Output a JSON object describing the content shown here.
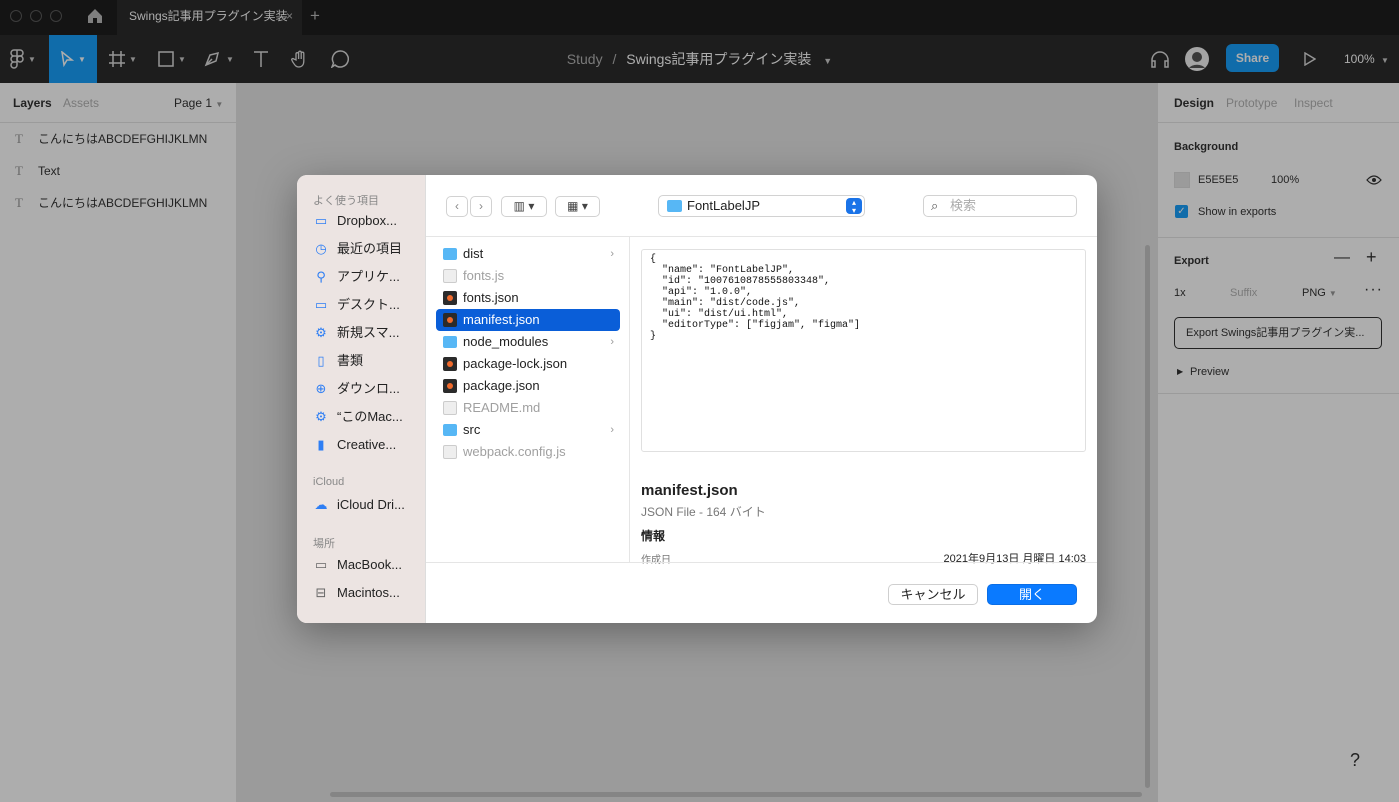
{
  "titlebar": {
    "tab_title": "Swings記事用プラグイン実装",
    "tab_close": "×",
    "new_tab": "+"
  },
  "toolbar": {
    "breadcrumb_project": "Study",
    "breadcrumb_separator": "/",
    "breadcrumb_file": "Swings記事用プラグイン実装",
    "share_label": "Share",
    "zoom": "100%"
  },
  "left_panel": {
    "tabs": [
      "Layers",
      "Assets"
    ],
    "page": "Page 1",
    "layers": [
      {
        "icon": "T",
        "label": "こんにちはABCDEFGHIJKLMN"
      },
      {
        "icon": "T",
        "label": "Text"
      },
      {
        "icon": "T",
        "label": "こんにちはABCDEFGHIJKLMN"
      }
    ]
  },
  "right_panel": {
    "tabs": [
      "Design",
      "Prototype",
      "Inspect"
    ],
    "background_title": "Background",
    "background_color": "E5E5E5",
    "background_opacity": "100%",
    "show_in_exports": "Show in exports",
    "export_title": "Export",
    "export_scale": "1x",
    "export_suffix_placeholder": "Suffix",
    "export_format": "PNG",
    "export_button": "Export Swings記事用プラグイン実...",
    "preview": "Preview"
  },
  "help_label": "?",
  "dialog": {
    "sidebar": {
      "favorites_title": "よく使う項目",
      "favorites": [
        {
          "icon": "folder-icon",
          "label": "Dropbox..."
        },
        {
          "icon": "clock-icon",
          "label": "最近の項目"
        },
        {
          "icon": "apps-icon",
          "label": "アプリケ..."
        },
        {
          "icon": "desktop-icon",
          "label": "デスクト..."
        },
        {
          "icon": "gear-folder-icon",
          "label": "新規スマ..."
        },
        {
          "icon": "document-icon",
          "label": "書類"
        },
        {
          "icon": "download-icon",
          "label": "ダウンロ..."
        },
        {
          "icon": "gear-folder-icon",
          "label": "“このMac..."
        },
        {
          "icon": "file-icon",
          "label": "Creative..."
        }
      ],
      "icloud_title": "iCloud",
      "icloud": [
        {
          "icon": "cloud-icon",
          "label": "iCloud Dri..."
        }
      ],
      "locations_title": "場所",
      "locations": [
        {
          "icon": "laptop-icon",
          "label": "MacBook..."
        },
        {
          "icon": "drive-icon",
          "label": "Macintos..."
        }
      ]
    },
    "location": "FontLabelJP",
    "search_placeholder": "検索",
    "files": [
      {
        "name": "dist",
        "type": "folder",
        "enabled": true
      },
      {
        "name": "fonts.js",
        "type": "script",
        "enabled": false
      },
      {
        "name": "fonts.json",
        "type": "json",
        "enabled": true
      },
      {
        "name": "manifest.json",
        "type": "json",
        "enabled": true,
        "selected": true
      },
      {
        "name": "node_modules",
        "type": "folder",
        "enabled": true
      },
      {
        "name": "package-lock.json",
        "type": "json",
        "enabled": true
      },
      {
        "name": "package.json",
        "type": "json",
        "enabled": true
      },
      {
        "name": "README.md",
        "type": "text",
        "enabled": false
      },
      {
        "name": "src",
        "type": "folder",
        "enabled": true
      },
      {
        "name": "webpack.config.js",
        "type": "script",
        "enabled": false
      }
    ],
    "preview": {
      "content": "{\n  \"name\": \"FontLabelJP\",\n  \"id\": \"1007610878555803348\",\n  \"api\": \"1.0.0\",\n  \"main\": \"dist/code.js\",\n  \"ui\": \"dist/ui.html\",\n  \"editorType\": [\"figjam\", \"figma\"]\n}",
      "filename": "manifest.json",
      "kind": "JSON File - 164 バイト",
      "info_title": "情報",
      "created_label": "作成日",
      "created_value": "2021年9月13日 月曜日 14:03"
    },
    "cancel_label": "キャンセル",
    "open_label": "開く"
  }
}
